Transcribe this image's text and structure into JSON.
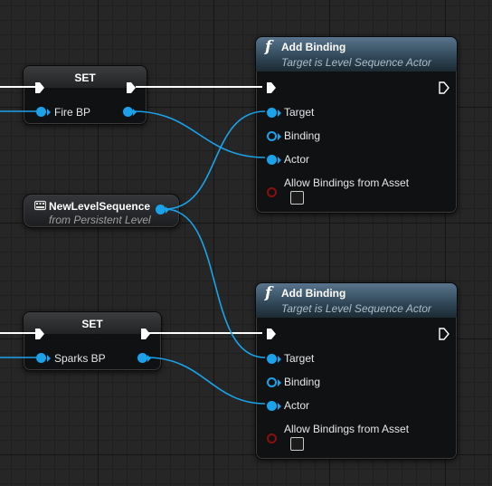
{
  "colors": {
    "object_pin": "#1aa3ea",
    "bool_pin": "#8b0f0f",
    "exec_wire": "#ffffff",
    "function_header": "#2f4656",
    "graph_background": "#262626"
  },
  "set_nodes": [
    {
      "title": "SET",
      "pin_label": "Fire BP"
    },
    {
      "title": "SET",
      "pin_label": "Sparks BP"
    }
  ],
  "get_node": {
    "title": "NewLevelSequence",
    "subtitle": "from Persistent Level",
    "icon": "level-sequence-icon"
  },
  "function_nodes": [
    {
      "icon": "function-icon",
      "title": "Add Binding",
      "subtitle": "Target is Level Sequence Actor",
      "pins": {
        "target": "Target",
        "binding": "Binding",
        "actor": "Actor",
        "allow": "Allow Bindings from Asset"
      }
    },
    {
      "icon": "function-icon",
      "title": "Add Binding",
      "subtitle": "Target is Level Sequence Actor",
      "pins": {
        "target": "Target",
        "binding": "Binding",
        "actor": "Actor",
        "allow": "Allow Bindings from Asset"
      }
    }
  ]
}
